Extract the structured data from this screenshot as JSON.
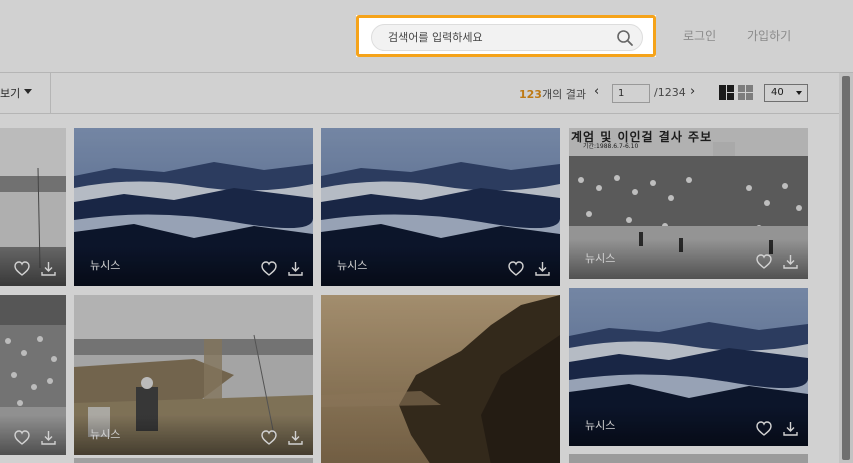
{
  "header": {
    "search_placeholder": "검색어를 입력하세요",
    "login_label": "로그인",
    "signup_label": "가입하기"
  },
  "toolbar": {
    "sort_label": "보기",
    "result_count": "123",
    "result_suffix": "개의 결과",
    "page_value": "1",
    "page_total": "/1234",
    "per_page_value": "40"
  },
  "cards": [
    {
      "source": ""
    },
    {
      "source": "뉴시스"
    },
    {
      "source": "뉴시스"
    },
    {
      "source": "뉴시스"
    },
    {
      "source": ""
    },
    {
      "source": "뉴시스"
    },
    {
      "source": ""
    },
    {
      "source": "뉴시스"
    }
  ],
  "banner_text": "계엄 및 이인걸 결사 주보",
  "banner_date": "기간:1988.6.7-6.10"
}
